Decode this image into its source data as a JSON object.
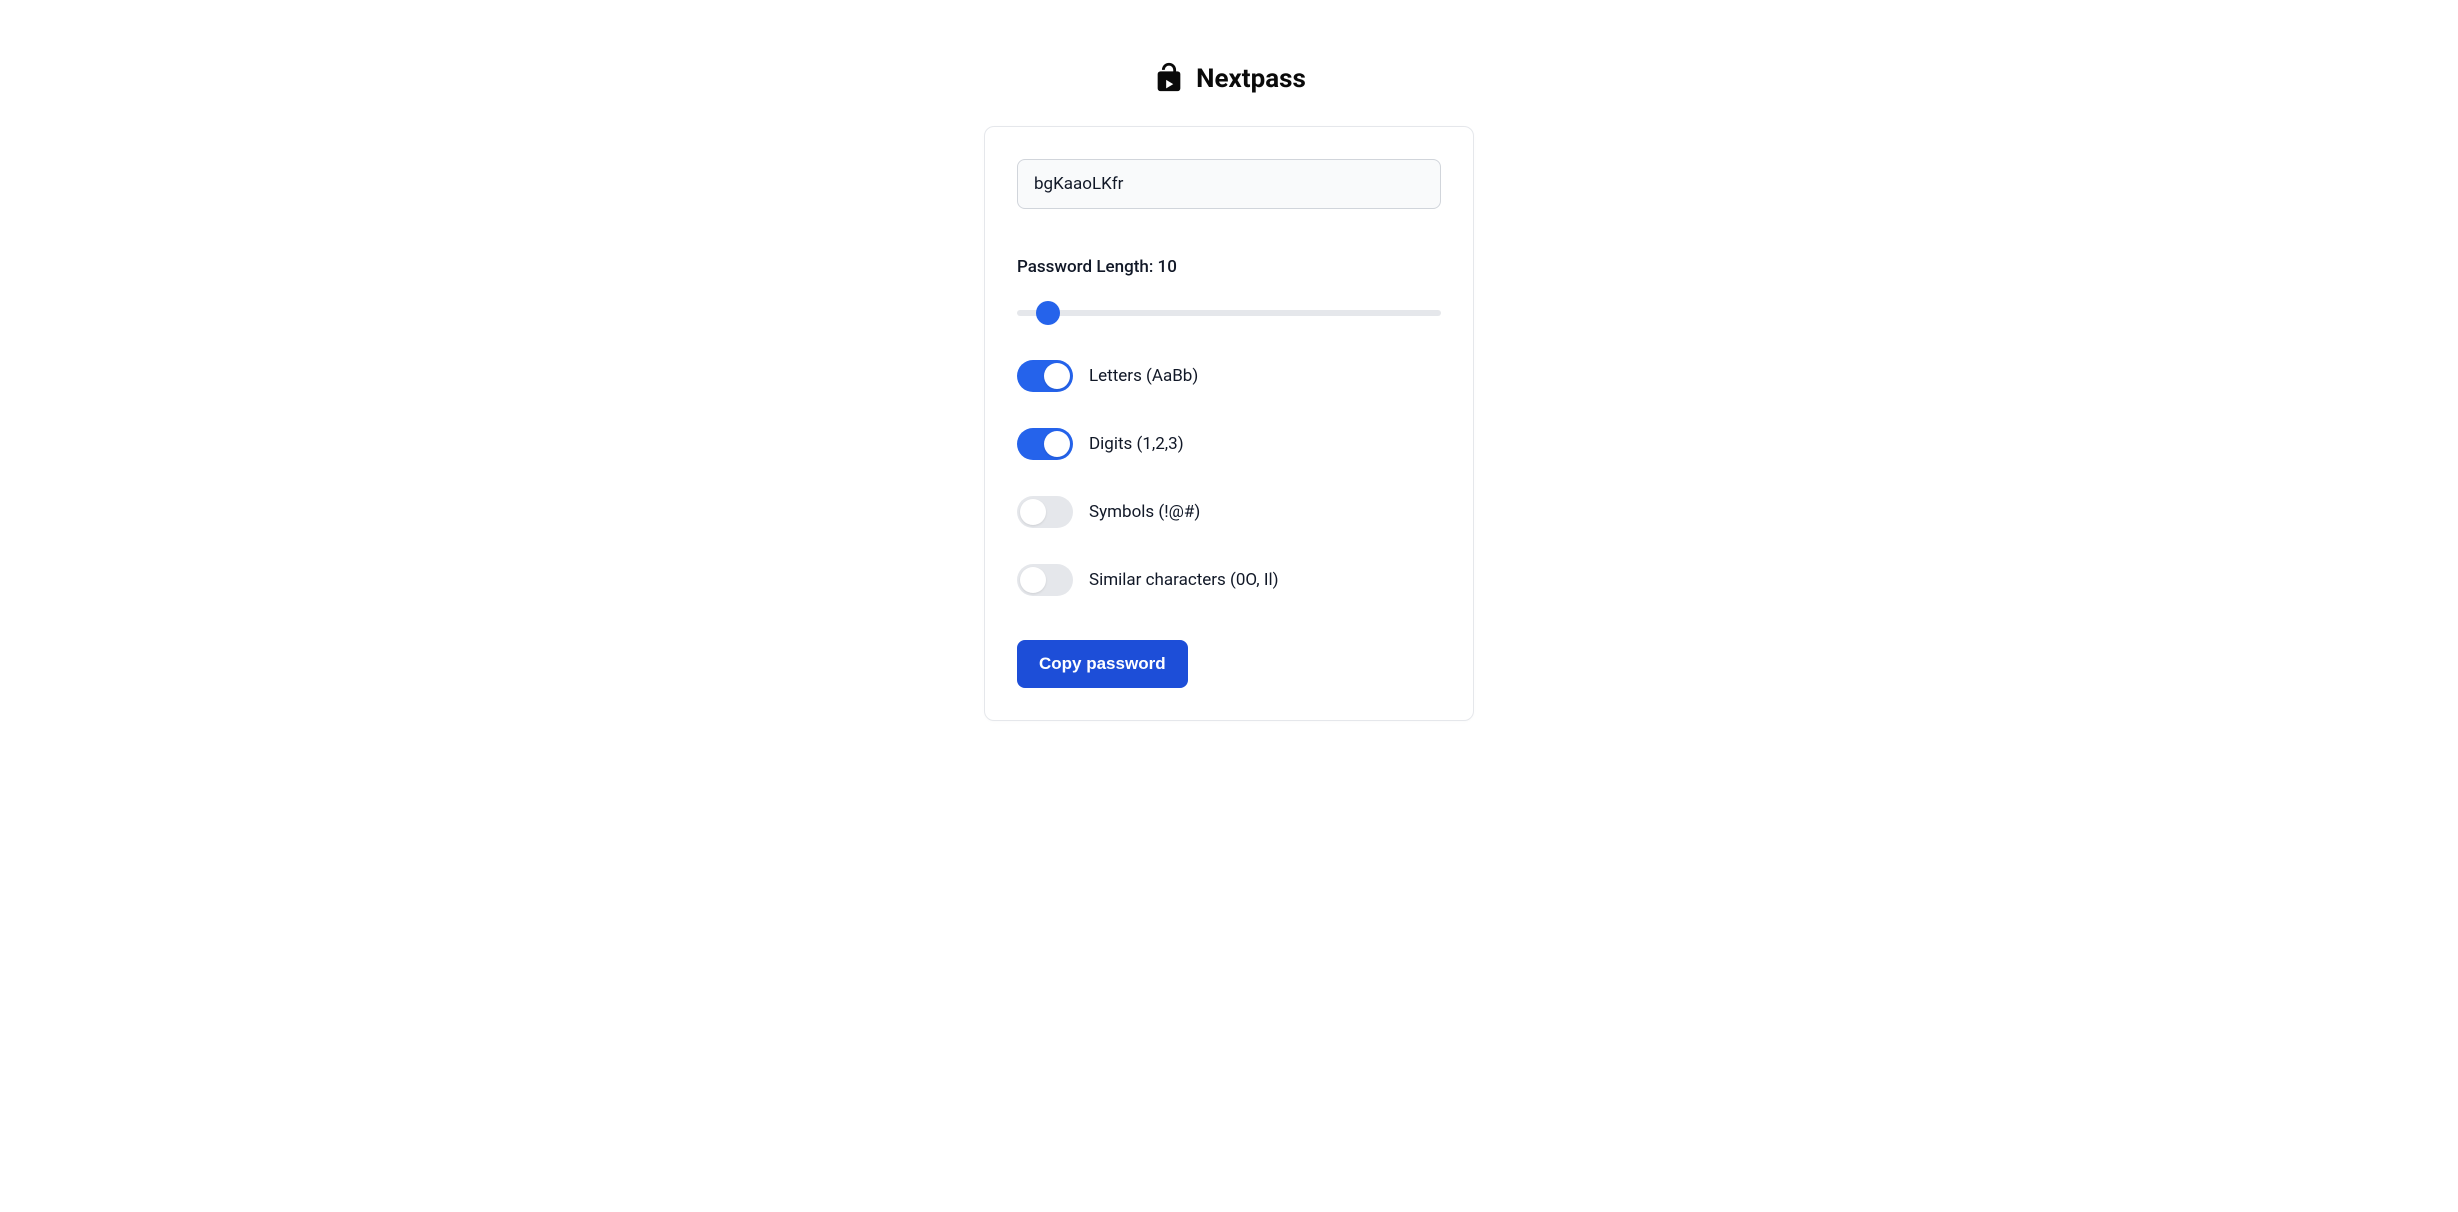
{
  "app": {
    "name": "Nextpass"
  },
  "password": {
    "value": "bgKaaoLKfr"
  },
  "length": {
    "label_prefix": "Password Length: ",
    "value": "10",
    "slider_min": "4",
    "slider_max": "128",
    "slider_value": "10"
  },
  "toggles": {
    "letters": {
      "label": "Letters (AaBb)",
      "on": true
    },
    "digits": {
      "label": "Digits (1,2,3)",
      "on": true
    },
    "symbols": {
      "label": "Symbols (!@#)",
      "on": false
    },
    "similar": {
      "label": "Similar characters (0O, Il)",
      "on": false
    }
  },
  "actions": {
    "copy": "Copy password"
  }
}
